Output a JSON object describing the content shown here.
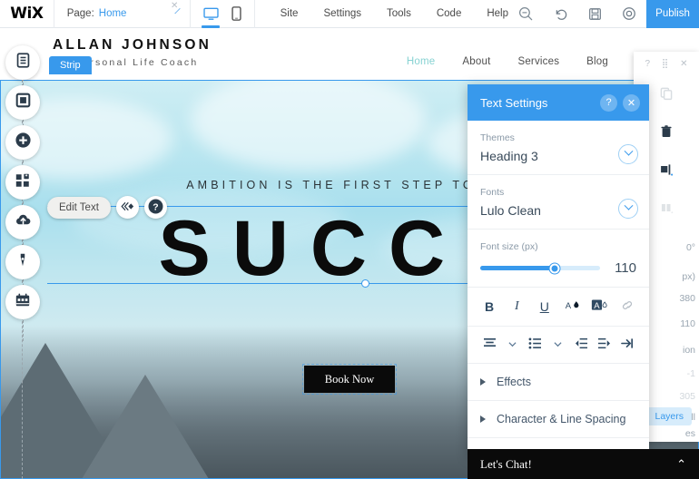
{
  "topbar": {
    "logo": "WiX",
    "page_label": "Page:",
    "page_value": "Home",
    "dropdown_icon": "chevron-down-icon",
    "desktop_icon": "desktop-view-icon",
    "mobile_icon": "mobile-view-icon",
    "menus": [
      "Site",
      "Settings",
      "Tools",
      "Code",
      "Help"
    ],
    "icons": [
      "zoom-out-icon",
      "undo-icon",
      "save-icon",
      "preview-icon"
    ],
    "publish_label": "Publish",
    "close_tooltip_icon": "close-icon"
  },
  "site": {
    "brand_name": "ALLAN JOHNSON",
    "brand_sub": "Personal Life Coach",
    "nav": [
      {
        "label": "Home",
        "active": true
      },
      {
        "label": "About",
        "active": false
      },
      {
        "label": "Services",
        "active": false
      },
      {
        "label": "Blog",
        "active": false
      }
    ],
    "strip_tab": "Strip",
    "hero_subtitle": "AMBITION IS THE FIRST STEP TOWAR",
    "hero_title": "SUCCE",
    "cta_label": "Book Now"
  },
  "left_rail": {
    "items": [
      {
        "name": "menus-pages-icon",
        "glyph": "☰"
      },
      {
        "name": "background-icon",
        "glyph": "▢"
      },
      {
        "name": "add-element-icon",
        "glyph": "＋"
      },
      {
        "name": "add-apps-icon",
        "glyph": "▣"
      },
      {
        "name": "my-uploads-icon",
        "glyph": "☁"
      },
      {
        "name": "blog-icon",
        "glyph": "✒"
      },
      {
        "name": "bookings-icon",
        "glyph": "Ὄ5"
      }
    ]
  },
  "edit_float": {
    "edit_text_label": "Edit Text",
    "animation_icon": "animation-icon",
    "help_icon": "help-icon"
  },
  "text_settings": {
    "title": "Text Settings",
    "help_icon": "help-icon",
    "close_icon": "close-icon",
    "themes_label": "Themes",
    "themes_value": "Heading 3",
    "fonts_label": "Fonts",
    "fonts_value": "Lulo Clean",
    "font_size_label": "Font size (px)",
    "font_size_value": "110",
    "format_tools": [
      {
        "name": "bold-icon",
        "glyph": "B"
      },
      {
        "name": "italic-icon",
        "glyph": "I"
      },
      {
        "name": "underline-icon",
        "glyph": "U"
      },
      {
        "name": "text-color-icon",
        "glyph": "A"
      },
      {
        "name": "text-highlight-icon",
        "glyph": "A"
      },
      {
        "name": "link-icon",
        "glyph": "🔗"
      }
    ],
    "align_tools": [
      {
        "name": "text-align-icon",
        "glyph": "≡"
      },
      {
        "name": "align-dropdown-icon",
        "glyph": "⌄"
      },
      {
        "name": "bullet-list-icon",
        "glyph": "☰"
      },
      {
        "name": "list-dropdown-icon",
        "glyph": "⌄"
      },
      {
        "name": "outdent-icon",
        "glyph": "⇤"
      },
      {
        "name": "indent-icon",
        "glyph": "⇥"
      },
      {
        "name": "text-direction-icon",
        "glyph": "↱"
      }
    ],
    "effects_label": "Effects",
    "spacing_label": "Character & Line Spacing"
  },
  "right_panel": {
    "header_icons": [
      "help-icon",
      "drag-handle-icon",
      "close-icon"
    ],
    "tools": [
      {
        "name": "copy-icon",
        "glyph": "❐"
      },
      {
        "name": "delete-icon",
        "glyph": "🗑"
      },
      {
        "name": "align-icon",
        "glyph": "◨"
      },
      {
        "name": "distribute-icon",
        "glyph": "◫"
      }
    ],
    "rotation_value": "0°",
    "size_label": "px)",
    "width_value": "380",
    "height_value": "110",
    "position_label": "ion",
    "x_value": "-1",
    "y_value": "305",
    "pin_text_line1": "on All",
    "pin_text_line2": "es",
    "layers_label": "Layers"
  },
  "chat": {
    "label": "Let's Chat!",
    "caret_icon": "chevron-up-icon"
  },
  "colors": {
    "accent": "#3899ec",
    "nav_active": "#86d2d2",
    "panel_text": "#394a5a",
    "cta_bg": "#0a0a0a"
  }
}
